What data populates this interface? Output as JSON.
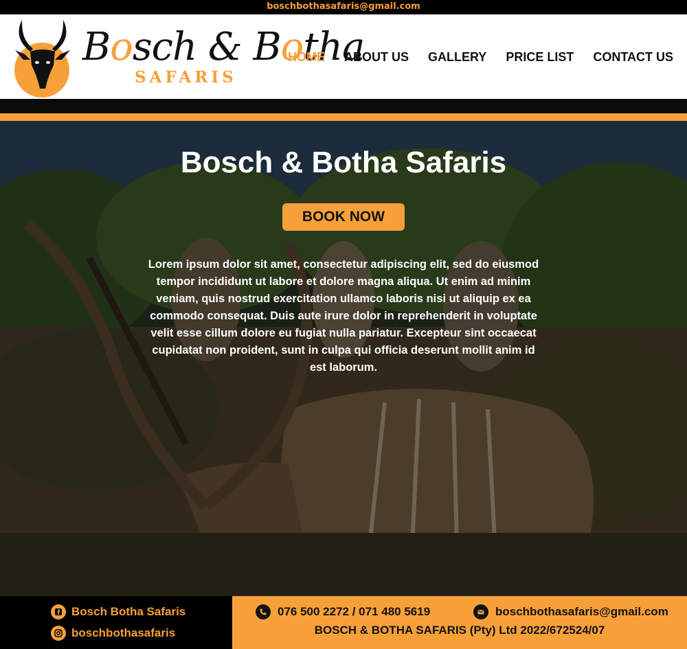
{
  "topbar": {
    "email": "boschbothasafaris@gmail.com"
  },
  "brand": {
    "script_first": "B",
    "script_o1": "o",
    "script_mid": "sch & B",
    "script_o2": "o",
    "script_end": "tha",
    "sub": "SAFARIS"
  },
  "nav": {
    "items": [
      {
        "label": "HOME",
        "active": true
      },
      {
        "label": "ABOUT US"
      },
      {
        "label": "GALLERY"
      },
      {
        "label": "PRICE LIST"
      },
      {
        "label": "CONTACT US"
      }
    ]
  },
  "hero": {
    "title": "Bosch & Botha Safaris",
    "cta": "BOOK NOW",
    "body": "Lorem ipsum dolor sit amet, consectetur adipiscing elit, sed do eiusmod tempor incididunt ut labore et dolore magna aliqua. Ut enim ad minim veniam, quis nostrud exercitation ullamco laboris nisi ut aliquip ex ea commodo consequat. Duis aute irure dolor in reprehenderit in voluptate velit esse cillum dolore eu fugiat nulla pariatur. Excepteur sint occaecat cupidatat non proident, sunt in culpa qui officia deserunt mollit anim id est laborum."
  },
  "footer": {
    "facebook": "Bosch Botha Safaris",
    "instagram": "boschbothasafaris",
    "phone": "076 500 2272 / 071 480 5619",
    "email": "boschbothasafaris@gmail.com",
    "registration": "BOSCH & BOTHA SAFARIS (Pty) Ltd 2022/672524/07"
  },
  "colors": {
    "accent": "#f7a03a",
    "dark": "#000000",
    "header_bg": "#ffffff"
  },
  "icons": [
    "antelope-logo-icon",
    "facebook-icon",
    "instagram-icon",
    "phone-icon",
    "mail-icon"
  ]
}
